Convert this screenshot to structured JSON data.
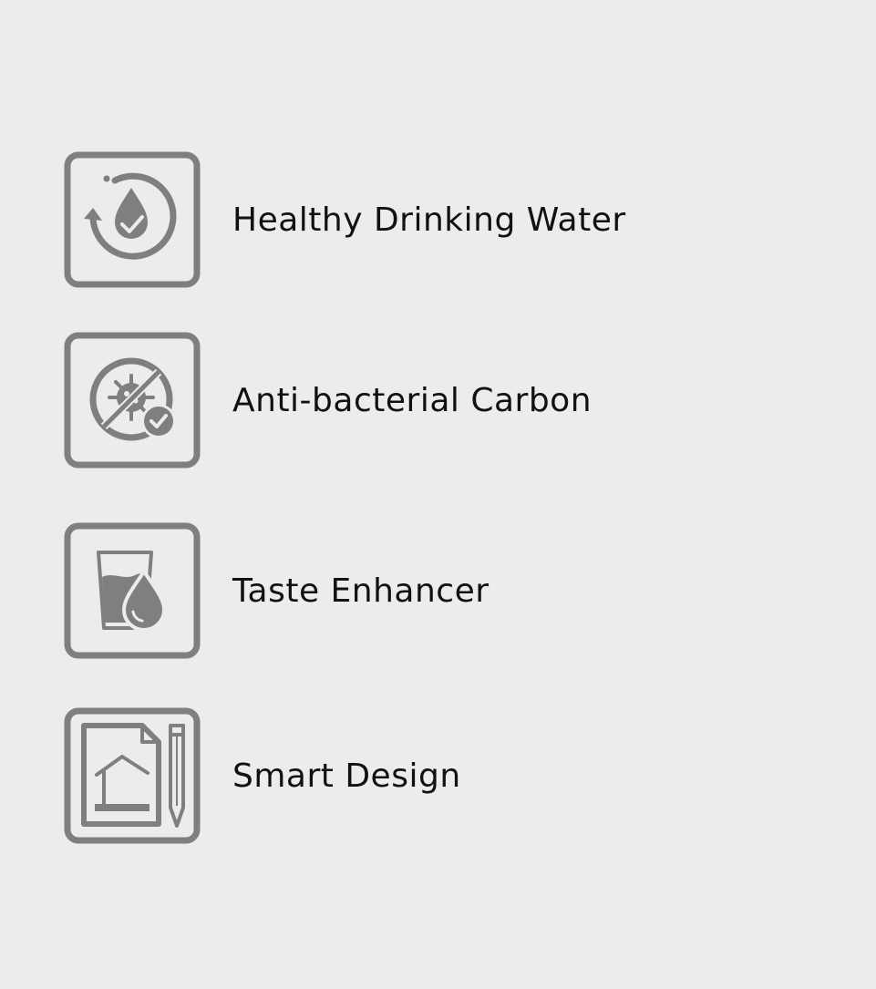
{
  "colors": {
    "background": "#ececec",
    "icon": "#7d7f80",
    "text": "#111111"
  },
  "features": [
    {
      "label": "Healthy Drinking Water",
      "icon": "water-drop-cycle-icon"
    },
    {
      "label": "Anti-bacterial Carbon",
      "icon": "no-bacteria-icon"
    },
    {
      "label": "Taste Enhancer",
      "icon": "glass-water-drop-icon"
    },
    {
      "label": "Smart Design",
      "icon": "blueprint-pencil-icon"
    }
  ]
}
